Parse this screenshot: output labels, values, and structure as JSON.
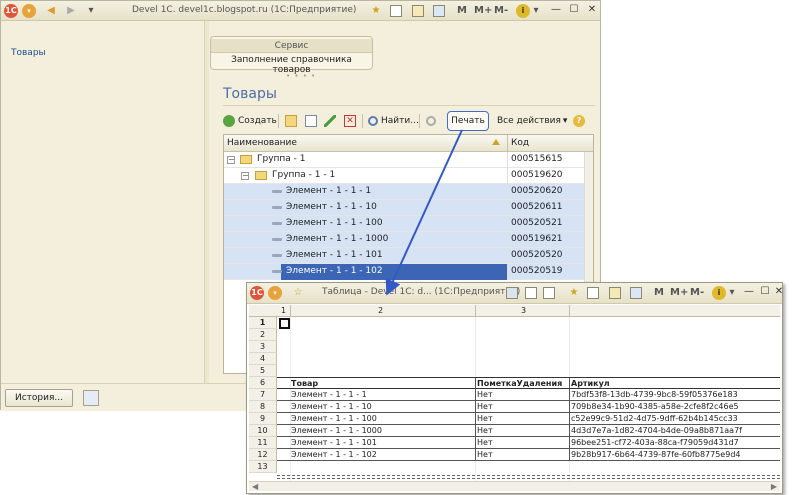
{
  "main_window": {
    "title": "Devel 1C. devel1c.blogspot.ru  (1С:Предприятие)",
    "menu_letters": [
      "M",
      "M+",
      "M-"
    ],
    "sidebar": {
      "items": [
        {
          "label": "Товары"
        }
      ]
    },
    "service": {
      "title": "Сервис",
      "link": "Заполнение справочника товаров"
    },
    "page_title": "Товары",
    "toolbar": {
      "create_label": "Создать",
      "find_label": "Найти...",
      "print_label": "Печать",
      "all_actions_label": "Все действия"
    },
    "table": {
      "columns": [
        "Наименование",
        "Код"
      ],
      "rows": [
        {
          "name": "Группа - 1",
          "code": "000515615",
          "kind": "group",
          "level": 0
        },
        {
          "name": "Группа - 1 - 1",
          "code": "000519620",
          "kind": "group",
          "level": 1
        },
        {
          "name": "Элемент - 1 - 1 - 1",
          "code": "000520620",
          "kind": "item",
          "level": 2
        },
        {
          "name": "Элемент - 1 - 1 - 10",
          "code": "000520611",
          "kind": "item",
          "level": 2
        },
        {
          "name": "Элемент - 1 - 1 - 100",
          "code": "000520521",
          "kind": "item",
          "level": 2
        },
        {
          "name": "Элемент - 1 - 1 - 1000",
          "code": "000519621",
          "kind": "item",
          "level": 2
        },
        {
          "name": "Элемент - 1 - 1 - 101",
          "code": "000520520",
          "kind": "item",
          "level": 2
        },
        {
          "name": "Элемент - 1 - 1 - 102",
          "code": "000520519",
          "kind": "item",
          "level": 2
        }
      ]
    },
    "history_label": "История..."
  },
  "report_window": {
    "title": "Таблица - Devel 1C: d... (1С:Предприятие)",
    "menu_letters": [
      "M",
      "M+",
      "M-"
    ],
    "column_headers": [
      "1",
      "2",
      "3"
    ],
    "row_numbers": [
      "1",
      "2",
      "3",
      "4",
      "5",
      "6",
      "7",
      "8",
      "9",
      "10",
      "11",
      "12",
      "13"
    ],
    "table_header": [
      "Товар",
      "ПометкаУдаления",
      "Артикул"
    ],
    "rows": [
      {
        "item": "Элемент - 1 - 1 - 1",
        "mark": "Нет",
        "article": "7bdf53f8-13db-4739-9bc8-59f05376e183"
      },
      {
        "item": "Элемент - 1 - 1 - 10",
        "mark": "Нет",
        "article": "709b8e34-1b90-4385-a58e-2cfe8f2c46e5"
      },
      {
        "item": "Элемент - 1 - 1 - 100",
        "mark": "Нет",
        "article": "c52e99c9-51d2-4d75-9dff-62b4b145cc33"
      },
      {
        "item": "Элемент - 1 - 1 - 1000",
        "mark": "Нет",
        "article": "4d3d7e7a-1d82-4704-b4de-09a8b871aa7f"
      },
      {
        "item": "Элемент - 1 - 1 - 101",
        "mark": "Нет",
        "article": "96bee251-cf72-403a-88ca-f79059d431d7"
      },
      {
        "item": "Элемент - 1 - 1 - 102",
        "mark": "Нет",
        "article": "9b28b917-6b64-4739-87fe-60fb8775e9d4"
      }
    ]
  },
  "colors": {
    "accent": "#4f6da6",
    "selection": "#d6e3f5",
    "active_row": "#3c66b5",
    "arrow": "#3558c7"
  }
}
